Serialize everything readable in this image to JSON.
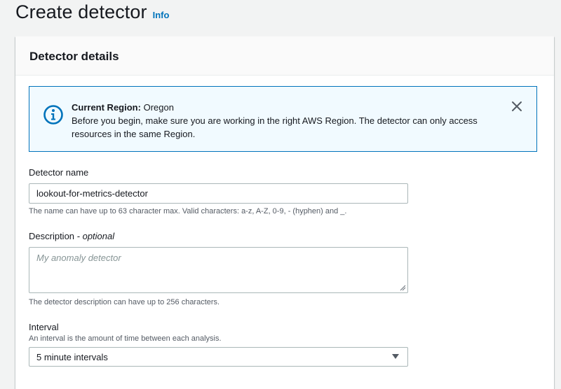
{
  "page": {
    "title": "Create detector",
    "info_link": "Info"
  },
  "panel": {
    "title": "Detector details"
  },
  "alert": {
    "icon": "info-circle-icon",
    "heading": "Current Region:",
    "region": "Oregon",
    "body": "Before you begin, make sure you are working in the right AWS Region. The detector can only access resources in the same Region.",
    "close_icon": "close-icon",
    "color": "#0073bb",
    "background": "#f1faff"
  },
  "fields": {
    "name": {
      "label": "Detector name",
      "value": "lookout-for-metrics-detector",
      "constraint": "The name can have up to 63 character max. Valid characters: a-z, A-Z, 0-9, - (hyphen) and _."
    },
    "description": {
      "label": "Description",
      "optional": "- optional",
      "placeholder": "My anomaly detector",
      "constraint": "The detector description can have up to 256 characters."
    },
    "interval": {
      "label": "Interval",
      "description": "An interval is the amount of time between each analysis.",
      "selected": "5 minute intervals",
      "caret_icon": "caret-down-icon"
    }
  },
  "colors": {
    "link": "#0073bb",
    "text": "#16191f",
    "secondary_text": "#545b64",
    "input_border": "#aab7b8"
  }
}
